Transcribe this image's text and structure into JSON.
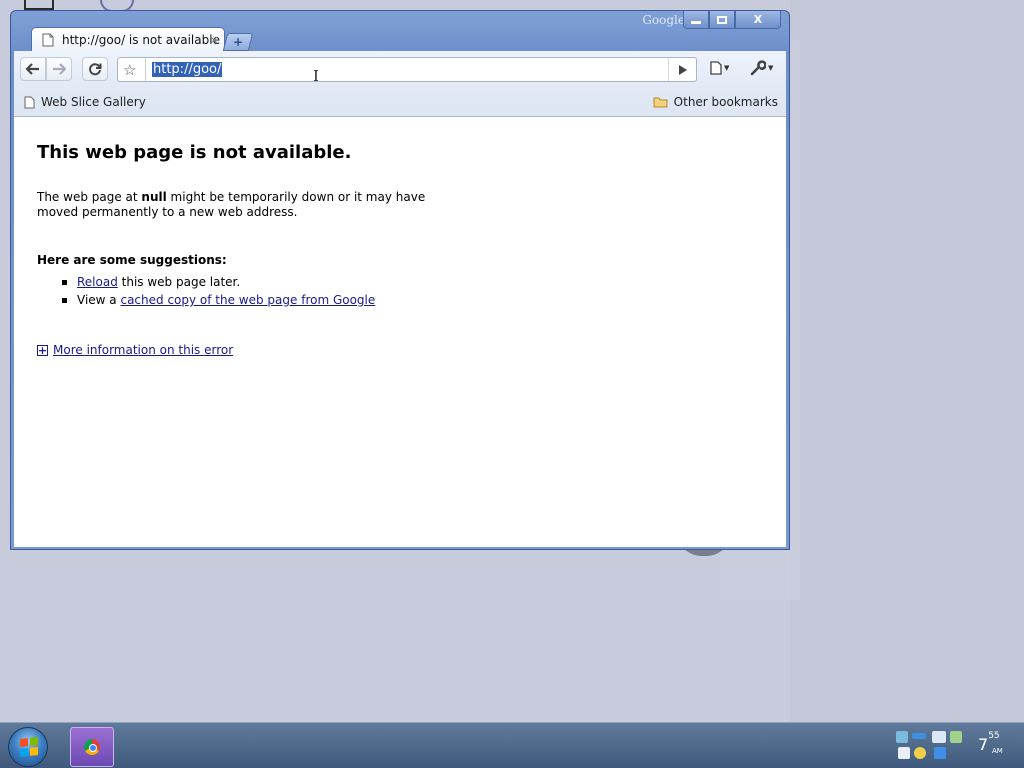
{
  "window": {
    "brand": "Google",
    "minimize_label": "minimize",
    "close_glyph": "X"
  },
  "tabs": [
    {
      "title": "http://goo/ is not available",
      "close_glyph": "×"
    }
  ],
  "new_tab_glyph": "+",
  "omnibox": {
    "url": "http://goo/"
  },
  "bookmarks": {
    "left": {
      "label": "Web Slice Gallery"
    },
    "right": {
      "label": "Other bookmarks"
    }
  },
  "error_page": {
    "title": "This web page is not available.",
    "desc_prefix": "The web page at ",
    "desc_bold": "null",
    "desc_suffix": " might be temporarily down or it may have moved permanently to a new web address.",
    "suggestions_heading": "Here are some suggestions:",
    "suggestions": [
      {
        "link": "Reload",
        "rest": " this web page later."
      },
      {
        "prefix": "View a ",
        "link": "cached copy of the web page from Google"
      }
    ],
    "more_info": "More information on this error"
  },
  "taskbar": {
    "clock_hour": "7",
    "clock_minutes": "55",
    "clock_ampm": "AM"
  },
  "colors": {
    "selection": "#3262b8",
    "link": "#1a1a8c",
    "window_frame": "#7c9ad2",
    "taskbar": "#4f6a8c"
  }
}
